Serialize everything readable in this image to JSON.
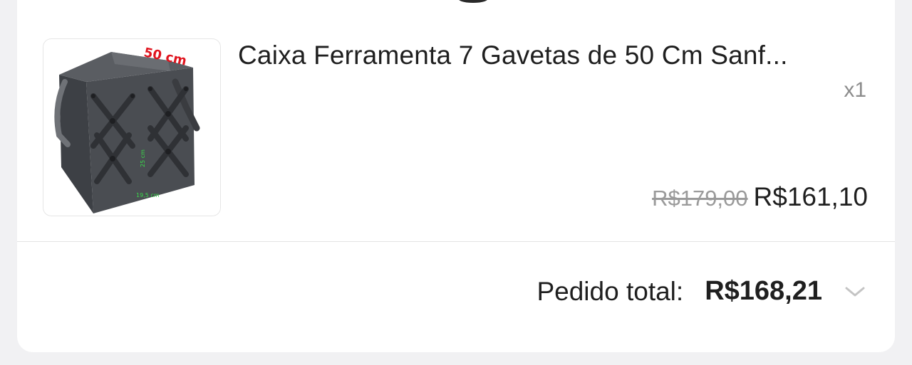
{
  "product": {
    "title": "Caixa Ferramenta 7 Gavetas de 50 Cm Sanf...",
    "quantity": "x1",
    "price_original": "R$179,00",
    "price_current": "R$161,10",
    "image_labels": {
      "width": "50 cm",
      "height": "25 cm",
      "depth": "19,5 cm"
    }
  },
  "order": {
    "total_label": "Pedido total:",
    "total_value": "R$168,21",
    "expand_icon": "chevron-down-icon"
  },
  "colors": {
    "text_primary": "#1f1f1f",
    "text_muted": "#9a9a9a",
    "image_label_red": "#e0141e",
    "image_label_green": "#39d94a",
    "box_gray": "#4a4d52"
  }
}
